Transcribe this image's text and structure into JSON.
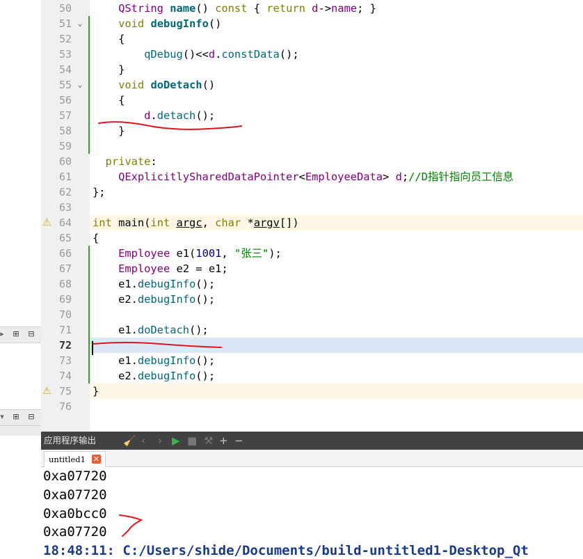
{
  "editor": {
    "lines": [
      {
        "num": "50",
        "html": "    <span class=\"ty\">QString</span> <span class=\"fnb\">name</span>() <span class=\"kw\">const</span> { <span class=\"kw\">return</span> <span class=\"ty\">d</span>-&gt;<span class=\"ty\">name</span>; }"
      },
      {
        "num": "51",
        "html": "    <span class=\"kw\">void</span> <span class=\"fnb\">debugInfo</span>()",
        "fold": true
      },
      {
        "num": "52",
        "html": "    {"
      },
      {
        "num": "53",
        "html": "        <span class=\"fn\">qDebug</span>()&lt;&lt;<span class=\"ty\">d</span>.<span class=\"fn\">constData</span>();"
      },
      {
        "num": "54",
        "html": "    }"
      },
      {
        "num": "55",
        "html": "    <span class=\"kw\">void</span> <span class=\"fnb\">doDetach</span>()",
        "fold": true
      },
      {
        "num": "56",
        "html": "    {"
      },
      {
        "num": "57",
        "html": "        <span class=\"ty\">d</span>.<span class=\"fn\">detach</span>();"
      },
      {
        "num": "58",
        "html": "    }"
      },
      {
        "num": "59",
        "html": ""
      },
      {
        "num": "60",
        "html": "  <span class=\"kw\">private</span>:"
      },
      {
        "num": "61",
        "html": "    <span class=\"ty\">QExplicitlySharedDataPointer</span>&lt;<span class=\"ty\">EmployeeData</span>&gt; <span class=\"ty\">d</span>;<span class=\"cm\">//D指针指向员工信息</span>"
      },
      {
        "num": "62",
        "html": "};"
      },
      {
        "num": "63",
        "html": ""
      },
      {
        "num": "64",
        "html": "<span class=\"kw\">int</span> main(<span class=\"kw\">int</span> <span class=\"ul\">argc</span>, <span class=\"kw\">char</span> *<span class=\"ul\">argv</span>[])",
        "warn": true
      },
      {
        "num": "65",
        "html": "{"
      },
      {
        "num": "66",
        "html": "    <span class=\"ty\">Employee</span> e1(<span class=\"num\">1001</span>, <span class=\"str\">\"张三\"</span>);"
      },
      {
        "num": "67",
        "html": "    <span class=\"ty\">Employee</span> e2 = e1;"
      },
      {
        "num": "68",
        "html": "    e1.<span class=\"fn\">debugInfo</span>();"
      },
      {
        "num": "69",
        "html": "    e2.<span class=\"fn\">debugInfo</span>();"
      },
      {
        "num": "70",
        "html": ""
      },
      {
        "num": "71",
        "html": "    e1.<span class=\"fn\">doDetach</span>();"
      },
      {
        "num": "72",
        "html": "",
        "current": true
      },
      {
        "num": "73",
        "html": "    e1.<span class=\"fn\">debugInfo</span>();"
      },
      {
        "num": "74",
        "html": "    e2.<span class=\"fn\">debugInfo</span>();"
      },
      {
        "num": "75",
        "html": "}",
        "warn": true
      },
      {
        "num": "76",
        "html": ""
      }
    ]
  },
  "output": {
    "pane_title": "应用程序输出",
    "tab_label": "untitled1",
    "lines": [
      "0xa07720",
      "0xa07720",
      "0xa0bcc0",
      "0xa07720"
    ],
    "status_line": "18:48:11: C:/Users/shide/Documents/build-untitled1-Desktop_Qt"
  },
  "icons": {
    "warning": "warning-icon",
    "fold": "fold-arrow-icon",
    "close": "close-icon",
    "run": "run-icon",
    "stop": "stop-icon",
    "add": "plus-icon",
    "remove": "minus-icon",
    "split": "split-icon",
    "collapse": "collapse-icon"
  },
  "colors": {
    "keyword": "#808000",
    "type": "#800080",
    "function": "#00677c",
    "string": "#008000",
    "number": "#000080",
    "current_line": "#dbe9f7",
    "warning_line": "#fdf8e6",
    "annotation": "#e0141e"
  }
}
